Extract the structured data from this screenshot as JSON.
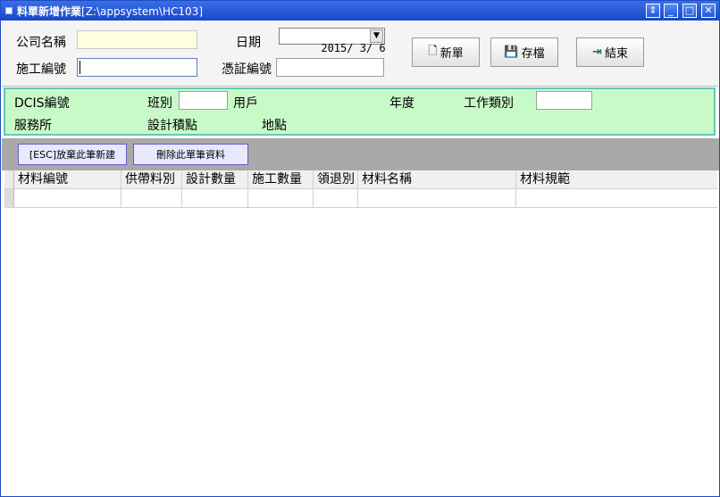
{
  "window": {
    "title": "料單新增作業",
    "path": "[Z:\\appsystem\\HC103]",
    "controls": [
      "⇕",
      "_",
      "□",
      "✕"
    ]
  },
  "form": {
    "company_name_label": "公司名稱",
    "company_name_value": "",
    "date_label": "日期",
    "date_value": "2015/ 3/ 6",
    "work_no_label": "施工編號",
    "work_no_value": "",
    "voucher_no_label": "憑証編號",
    "voucher_no_value": ""
  },
  "buttons": {
    "new": "新單",
    "save": "存檔",
    "end": "結束"
  },
  "info": {
    "dcis_label": "DCIS編號",
    "shift_label": "班別",
    "shift_value": "",
    "customer_label": "用戶",
    "year_label": "年度",
    "work_type_label": "工作類別",
    "work_type_value": "",
    "office_label": "服務所",
    "design_points_label": "設計積點",
    "location_label": "地點"
  },
  "actions": {
    "abandon": "[ESC]放棄此筆新建",
    "delete": "刪除此單筆資料"
  },
  "grid": {
    "columns": [
      "材料編號",
      "供帶料別",
      "設計數量",
      "施工數量",
      "領退別",
      "材料名稱",
      "材料規範"
    ]
  }
}
